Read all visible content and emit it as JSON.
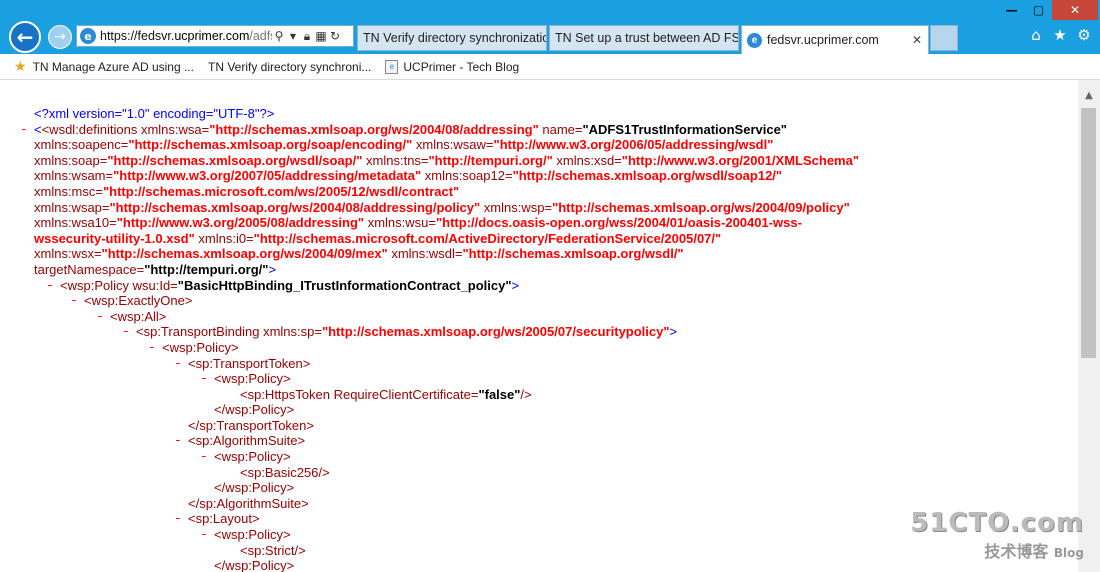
{
  "window": {
    "min": "—",
    "max": "▢",
    "close": "✕"
  },
  "nav": {
    "back_icon": "back-arrow-icon",
    "forward_icon": "forward-arrow-icon"
  },
  "address": {
    "url_prefix": "https://fedsvr.",
    "url_domain": "ucprimer.com",
    "url_rest": "/adfs...",
    "search_icon": "search-icon",
    "lock_icon": "lock-icon",
    "compat_icon": "compatibility-icon",
    "refresh_icon": "refresh-icon"
  },
  "tabs": [
    {
      "label": "TN Verify directory synchronization"
    },
    {
      "label": "TN Set up a trust between AD FS a..."
    },
    {
      "label": "fedsvr.ucprimer.com",
      "active": true
    }
  ],
  "toolbar": {
    "home": "⌂",
    "favorites": "★",
    "settings": "⚙"
  },
  "favorites": [
    {
      "label": "TN Manage Azure AD using ..."
    },
    {
      "label": "TN Verify directory synchroni..."
    },
    {
      "label": "UCPrimer - Tech Blog"
    }
  ],
  "xml": {
    "decl": "<?xml version=\"1.0\" encoding=\"UTF-8\"?>",
    "defs_tag": "<wsdl:definitions",
    "a_wsa": " xmlns:wsa=",
    "v_wsa": "\"http://schemas.xmlsoap.org/ws/2004/08/addressing\"",
    "a_name": " name=",
    "v_name": "\"ADFS1TrustInformationService\"",
    "a_soapenc": "xmlns:soapenc=",
    "v_soapenc": "\"http://schemas.xmlsoap.org/soap/encoding/\"",
    "a_wsaw": " xmlns:wsaw=",
    "v_wsaw": "\"http://www.w3.org/2006/05/addressing/wsdl\"",
    "a_soap": "xmlns:soap=",
    "v_soap": "\"http://schemas.xmlsoap.org/wsdl/soap/\"",
    "a_tns": " xmlns:tns=",
    "v_tns": "\"http://tempuri.org/\"",
    "a_xsd": " xmlns:xsd=",
    "v_xsd": "\"http://www.w3.org/2001/XMLSchema\"",
    "a_wsam": "xmlns:wsam=",
    "v_wsam": "\"http://www.w3.org/2007/05/addressing/metadata\"",
    "a_soap12": " xmlns:soap12=",
    "v_soap12": "\"http://schemas.xmlsoap.org/wsdl/soap12/\"",
    "a_msc": "xmlns:msc=",
    "v_msc": "\"http://schemas.microsoft.com/ws/2005/12/wsdl/contract\"",
    "a_wsap": "xmlns:wsap=",
    "v_wsap": "\"http://schemas.xmlsoap.org/ws/2004/08/addressing/policy\"",
    "a_wsp": " xmlns:wsp=",
    "v_wsp": "\"http://schemas.xmlsoap.org/ws/2004/09/policy\"",
    "a_wsa10": "xmlns:wsa10=",
    "v_wsa10": "\"http://www.w3.org/2005/08/addressing\"",
    "a_wsu": " xmlns:wsu=",
    "v_wsu1": "\"http://docs.oasis-open.org/wss/2004/01/oasis-200401-wss-",
    "v_wsu2": "wssecurity-utility-1.0.xsd\"",
    "a_i0": " xmlns:i0=",
    "v_i0": "\"http://schemas.microsoft.com/ActiveDirectory/FederationService/2005/07/\"",
    "a_wsx": "xmlns:wsx=",
    "v_wsx": "\"http://schemas.xmlsoap.org/ws/2004/09/mex\"",
    "a_wsdl": " xmlns:wsdl=",
    "v_wsdl": "\"http://schemas.xmlsoap.org/wsdl/\"",
    "a_target": "targetNamespace=",
    "v_target": "\"http://tempuri.org/\"",
    "close_gt": ">",
    "policy_open": "<wsp:Policy",
    "a_wsuid": " wsu:Id=",
    "v_wsuid": "\"BasicHttpBinding_ITrustInformationContract_policy\"",
    "exactlyone": "<wsp:ExactlyOne>",
    "all": "<wsp:All>",
    "transport_open": "<sp:TransportBinding",
    "a_sp": " xmlns:sp=",
    "v_sp": "\"http://schemas.xmlsoap.org/ws/2005/07/securitypolicy\"",
    "wsp_policy": "<wsp:Policy>",
    "transport_token": "<sp:TransportToken>",
    "https_open": "<sp:HttpsToken",
    "a_rcc": " RequireClientCertificate=",
    "v_rcc": "\"false\"",
    "selfclose": "/>",
    "wsp_policy_close": "</wsp:Policy>",
    "transport_token_close": "</sp:TransportToken>",
    "algsuite": "<sp:AlgorithmSuite>",
    "basic256": "<sp:Basic256/>",
    "algsuite_close": "</sp:AlgorithmSuite>",
    "layout": "<sp:Layout>",
    "strict": "<sp:Strict/>",
    "minus": "-"
  },
  "watermark": {
    "big": "51CTO.com",
    "small": "技术博客",
    "blog": "Blog"
  }
}
